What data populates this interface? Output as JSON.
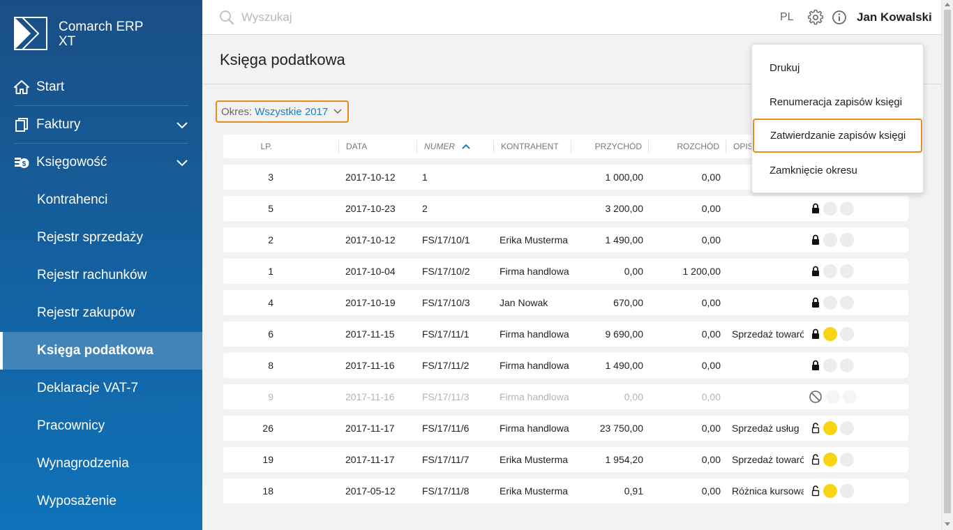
{
  "app": {
    "name": "Comarch ERP XT",
    "name_line1": "Comarch ERP",
    "name_line2": "XT"
  },
  "sidebar": {
    "items": [
      {
        "label": "Start",
        "icon": "home-icon"
      },
      {
        "label": "Faktury",
        "icon": "document-icon"
      },
      {
        "label": "Księgowość",
        "icon": "coins-icon"
      }
    ],
    "sub_items": [
      {
        "label": "Kontrahenci"
      },
      {
        "label": "Rejestr sprzedaży"
      },
      {
        "label": "Rejestr rachunków"
      },
      {
        "label": "Rejestr zakupów"
      },
      {
        "label": "Księga podatkowa",
        "active": true
      },
      {
        "label": "Deklaracje VAT-7"
      },
      {
        "label": "Pracownicy"
      },
      {
        "label": "Wynagrodzenia"
      },
      {
        "label": "Wyposażenie"
      }
    ]
  },
  "topbar": {
    "search_placeholder": "Wyszukaj",
    "lang": "PL",
    "user": "Jan Kowalski"
  },
  "page": {
    "title": "Księga podatkowa"
  },
  "filter": {
    "label": "Okres:",
    "value": "Wszystkie 2017"
  },
  "table": {
    "headers": {
      "lp": "LP.",
      "date": "DATA",
      "number": "NUMER",
      "contractor": "KONTRAHENT",
      "income": "PRZYCHÓD",
      "expense": "ROZCHÓD",
      "description": "OPIS"
    },
    "sort_column": "NUMER",
    "sort_direction": "ascending",
    "rows": [
      {
        "lp": "3",
        "date": "2017-10-12",
        "number": "1",
        "contractor": "",
        "income": "1 000,00",
        "expense": "0,00",
        "description": "",
        "lock": "locked",
        "dot": "grey",
        "disabled": false,
        "hidden_by_menu": true
      },
      {
        "lp": "5",
        "date": "2017-10-23",
        "number": "2",
        "contractor": "",
        "income": "3 200,00",
        "expense": "0,00",
        "description": "",
        "lock": "locked",
        "dot": "grey",
        "disabled": false
      },
      {
        "lp": "2",
        "date": "2017-10-12",
        "number": "FS/17/10/1",
        "contractor": "Erika Musterma",
        "income": "1 490,00",
        "expense": "0,00",
        "description": "",
        "lock": "locked",
        "dot": "grey",
        "disabled": false
      },
      {
        "lp": "1",
        "date": "2017-10-04",
        "number": "FS/17/10/2",
        "contractor": "Firma handlowa",
        "income": "0,00",
        "expense": "1 200,00",
        "description": "",
        "lock": "locked",
        "dot": "grey",
        "disabled": false
      },
      {
        "lp": "4",
        "date": "2017-10-19",
        "number": "FS/17/10/3",
        "contractor": "Jan Nowak",
        "income": "670,00",
        "expense": "0,00",
        "description": "",
        "lock": "locked",
        "dot": "grey",
        "disabled": false
      },
      {
        "lp": "6",
        "date": "2017-11-15",
        "number": "FS/17/11/1",
        "contractor": "Firma handlowa",
        "income": "9 690,00",
        "expense": "0,00",
        "description": "Sprzedaż towarów",
        "lock": "locked",
        "dot": "yellow",
        "disabled": false
      },
      {
        "lp": "8",
        "date": "2017-11-16",
        "number": "FS/17/11/2",
        "contractor": "Firma handlowa",
        "income": "1 490,00",
        "expense": "0,00",
        "description": "",
        "lock": "locked",
        "dot": "grey",
        "disabled": false
      },
      {
        "lp": "9",
        "date": "2017-11-16",
        "number": "FS/17/11/3",
        "contractor": "Firma handlowa",
        "income": "0,00",
        "expense": "0,00",
        "description": "",
        "lock": "cancelled",
        "dot": "grey",
        "disabled": true
      },
      {
        "lp": "26",
        "date": "2017-11-17",
        "number": "FS/17/11/6",
        "contractor": "Firma handlowa",
        "income": "23 750,00",
        "expense": "0,00",
        "description": "Sprzedaż usług",
        "lock": "unlocked",
        "dot": "yellow",
        "disabled": false
      },
      {
        "lp": "19",
        "date": "2017-11-17",
        "number": "FS/17/11/7",
        "contractor": "Erika Musterma",
        "income": "1 954,20",
        "expense": "0,00",
        "description": "Sprzedaż towarów",
        "lock": "unlocked",
        "dot": "yellow",
        "disabled": false
      },
      {
        "lp": "18",
        "date": "2017-05-12",
        "number": "FS/17/11/8",
        "contractor": "Erika Musterma",
        "income": "0,91",
        "expense": "0,00",
        "description": "Różnica kursowa",
        "lock": "unlocked",
        "dot": "yellow",
        "disabled": false
      }
    ]
  },
  "menu": {
    "items": [
      {
        "label": "Drukuj"
      },
      {
        "label": "Renumeracja zapisów księgi"
      },
      {
        "label": "Zatwierdzanie zapisów księgi",
        "highlighted": true
      },
      {
        "label": "Zamknięcie okresu"
      }
    ]
  },
  "colors": {
    "sidebar_top": "#1a4f86",
    "sidebar_bottom": "#0f72b9",
    "accent_orange": "#e88a1a",
    "link_blue": "#1b7fc3",
    "status_yellow": "#f7d512",
    "status_grey": "#ececec"
  }
}
